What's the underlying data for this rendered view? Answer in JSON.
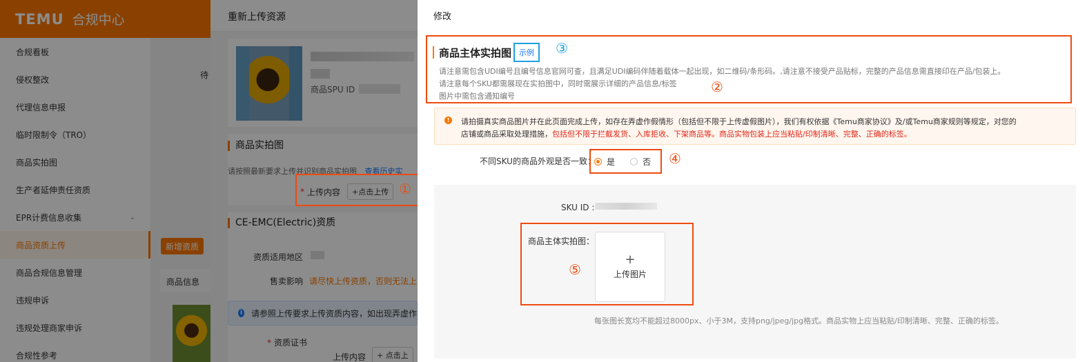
{
  "sidebar": {
    "logo": "TEMU",
    "title": "合规中心",
    "items": [
      {
        "label": "合规看板"
      },
      {
        "label": "侵权整改"
      },
      {
        "label": "代理信息申报"
      },
      {
        "label": "临时限制令（TRO）"
      },
      {
        "label": "商品实拍图"
      },
      {
        "label": "生产者延伸责任资质"
      },
      {
        "label": "EPR计费信息收集"
      },
      {
        "label": "商品资质上传"
      },
      {
        "label": "商品合规信息管理"
      },
      {
        "label": "违规申诉"
      },
      {
        "label": "违规处理商家申诉"
      },
      {
        "label": "合规性参考"
      }
    ],
    "active_index": 7
  },
  "background_page": {
    "cut_label": "待",
    "add_button": "新增资质",
    "product_info_header": "商品信息"
  },
  "reupload_drawer": {
    "title": "重新上传资源",
    "spu_label": "商品SPU ID",
    "section_photos": "商品实拍图",
    "photos_note": "请按照最新要求上传并识别商品实拍图",
    "history_link": "查看历史实",
    "upload_content_label": "上传内容",
    "upload_button": "+点击上传",
    "section_cert": "CE-EMC(Electric)资质",
    "region_label": "资质适用地区",
    "impact_label": "售卖影响",
    "impact_text": "请尽快上传资质，否则无法上",
    "info_text": "请参照上传要求上传资质内容，如出现弄虚作",
    "cert_label": "资质证书",
    "cert_upload_label": "上传内容",
    "cert_upload_button": "+ 点击上"
  },
  "edit_modal": {
    "title": "修改",
    "main_photo_title": "商品主体实拍图",
    "example_link": "示例",
    "desc_lines": [
      "请注意需包含UDI编号且编号信息官网可查，且满足UDI编码伴随着载体一起出现，如二维码/条形码。,请注意不接受产品贴标，完整的产品信息需直接印在产品/包装上。",
      "请注意每个SKU都需展现在实拍图中，同时需展示详细的产品信息/标签",
      "图片中需包含通知编号"
    ],
    "alert_line1": "请拍摄真实商品图片并在此页面完成上传，如存在弄虚作假情形（包括但不限于上传虚假图片），我们有权依据《Temu商家协议》及/或Temu商家规则等规定，对您的",
    "alert_line2_normal": "店铺或商品采取处理措施，",
    "alert_line2_red": "包括但不限于拦截发货、入库拒收、下架商品等。商品实物包装上应当粘贴/印制清晰、完整、正确的标签。",
    "consistency_question": "不同SKU的商品外观是否一致：",
    "option_yes": "是",
    "option_no": "否",
    "selected_option": "是",
    "sku_id_label": "SKU ID :",
    "main_image_label": "商品主体实拍图：",
    "upload_image": "上传图片",
    "upload_plus": "+",
    "image_hint": "每张图长宽均不能超过8000px、小于3M，支持png/jpeg/jpg格式。商品实物上应当粘贴/印制清晰、完整、正确的标签。"
  },
  "annotations": {
    "n1": "①",
    "n2": "②",
    "n3": "③",
    "n4": "④",
    "n5": "⑤"
  },
  "colors": {
    "brand_orange": "#fb7701",
    "annotation_red": "#ee4b0e",
    "annotation_blue": "#1ea0e0",
    "link_blue": "#1677ff",
    "alert_red": "#e0271a"
  }
}
